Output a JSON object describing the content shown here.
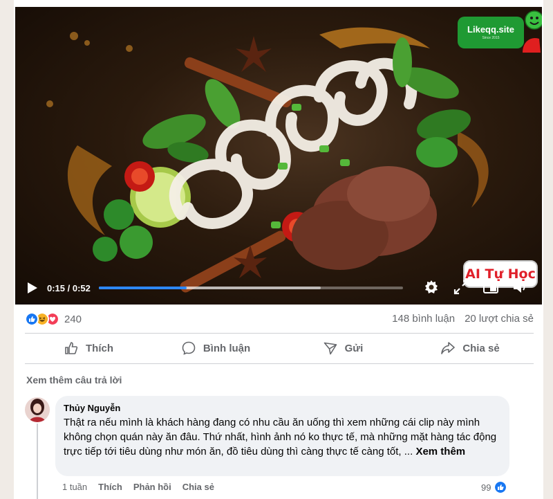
{
  "video": {
    "time_label": "0:15 / 0:52",
    "progress_fraction": 0.288,
    "buffered_fraction": 0.73,
    "channel_badge": "AI Tự Học",
    "brand_name": "Likeqq.site",
    "brand_since": "Since 2015",
    "icons": [
      "play-icon",
      "settings-gear-icon",
      "expand-icon",
      "pip-icon",
      "volume-icon"
    ]
  },
  "reactions": {
    "count": "240",
    "icons": [
      "like-reaction-icon",
      "haha-reaction-icon",
      "love-reaction-icon"
    ],
    "colors": {
      "like": "#1877f2",
      "haha": "#f7b125",
      "love": "#f33e58"
    }
  },
  "stats": {
    "comments": "148 bình luận",
    "shares": "20 lượt chia sẻ"
  },
  "actions": {
    "like": "Thích",
    "comment": "Bình luận",
    "send": "Gửi",
    "share": "Chia sẻ"
  },
  "more_replies": "Xem thêm câu trả lời",
  "comment": {
    "author": "Thủy Nguyễn",
    "text": "Thật ra nếu mình là khách hàng đang có nhu cầu ăn uống thì xem những cái clip này mình không chọn quán này ăn đâu. Thứ nhất, hình ảnh nó ko thực tế, mà những mặt hàng tác động trực tiếp tới tiêu dùng như món ăn, đồ tiêu dùng thì càng thực tế càng tốt, ...",
    "see_more": "Xem thêm",
    "time": "1 tuần",
    "like": "Thích",
    "reply": "Phản hồi",
    "share": "Chia sẻ",
    "like_count": "99"
  }
}
